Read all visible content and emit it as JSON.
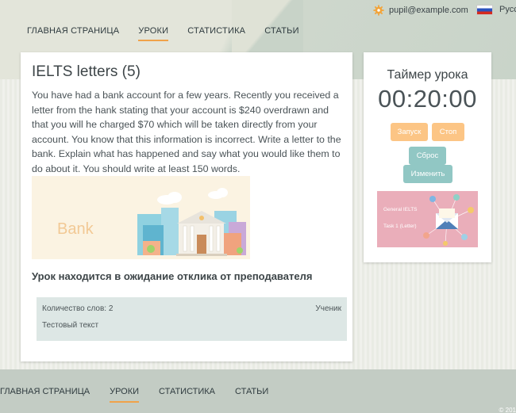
{
  "header": {
    "user_email": "pupil@example.com",
    "language": "Русс"
  },
  "nav": {
    "items": [
      {
        "label": "ГЛАВНАЯ СТРАНИЦА",
        "active": false
      },
      {
        "label": "УРОКИ",
        "active": true
      },
      {
        "label": "СТАТИСТИКА",
        "active": false
      },
      {
        "label": "СТАТЬИ",
        "active": false
      }
    ]
  },
  "lesson": {
    "title": "IELTS letters (5)",
    "task": "You have had a bank account for a few years. Recently you received a letter from the hank stating that your account is $240 overdrawn and that you will he charged $70 which will be taken directly from your account. You know that this information is incorrect. Write a letter to the bank. Explain what has happened and say what you would like them to do about it. You should write at least 150 words.",
    "image_caption": "Bank",
    "status": "Урок находится в ожидание отклика от преподавателя"
  },
  "answer": {
    "word_count": "Количество слов: 2",
    "role": "Ученик",
    "text": "Тестовый текст"
  },
  "timer": {
    "title": "Таймер урока",
    "time": "00:20:00",
    "start_label": "Запуск",
    "stop_label": "Стоп",
    "reset_label": "Сброс",
    "change_label": "Изменить",
    "promo_line1": "General IELTS",
    "promo_line2": "Task 1 (Letter)"
  },
  "footer": {
    "items": [
      {
        "label": "ГЛАВНАЯ СТРАНИЦА",
        "active": false
      },
      {
        "label": "УРОКИ",
        "active": true
      },
      {
        "label": "СТАТИСТИКА",
        "active": false
      },
      {
        "label": "СТАТЬИ",
        "active": false
      }
    ],
    "copyright": "© 201"
  },
  "colors": {
    "accent": "#f0a24a",
    "button_orange": "#fcc585",
    "button_teal": "#91c7c4"
  }
}
